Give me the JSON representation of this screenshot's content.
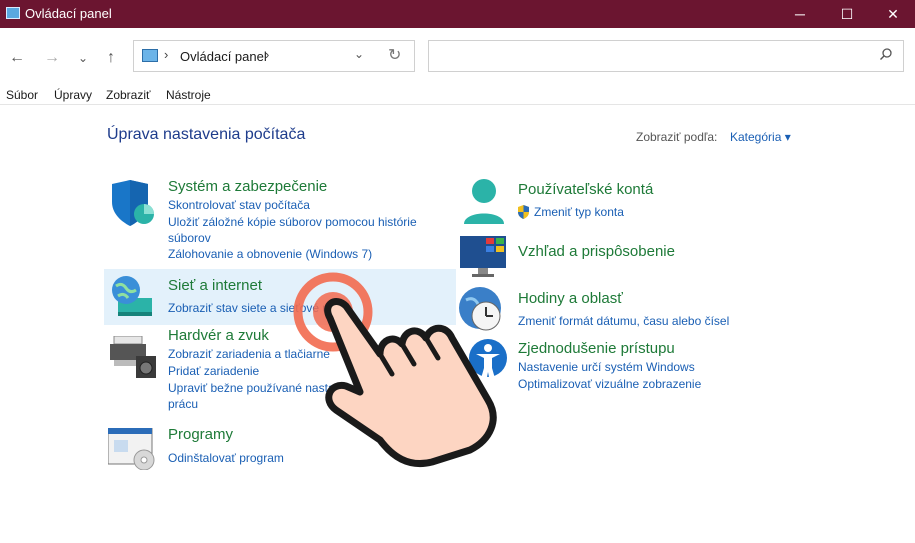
{
  "window": {
    "title": "Ovládací panel",
    "minimize": "─",
    "maximize": "☐",
    "close": "✕"
  },
  "nav": {
    "back": "←",
    "forward": "→",
    "recent": "⌄",
    "up": "↑"
  },
  "address": {
    "sep1": "›",
    "crumb": "Ovládací panel",
    "sep2": "›",
    "dropdown": "⌄",
    "refresh": "↻"
  },
  "search": {
    "placeholder": ""
  },
  "menu": [
    "Súbor",
    "Úpravy",
    "Zobraziť",
    "Nástroje"
  ],
  "main": {
    "title": "Úprava nastavenia počítača",
    "view_by_label": "Zobraziť podľa:",
    "view_by_value": "Kategória ▾"
  },
  "categories": {
    "system": {
      "title": "Systém a zabezpečenie",
      "links": [
        "Skontrolovať stav počítača",
        "Uložiť záložné kópie súborov pomocou histórie",
        "súborov",
        "Zálohovanie a obnovenie (Windows 7)"
      ]
    },
    "network": {
      "title": "Sieť a internet",
      "links": [
        "Zobraziť stav siete a sieťové úlohy"
      ]
    },
    "hardware": {
      "title": "Hardvér a zvuk",
      "links": [
        "Zobraziť zariadenia a tlačiarne",
        "Pridať zariadenie",
        "Upraviť bežne používané nastavenia mobility",
        "prácu"
      ]
    },
    "programs": {
      "title": "Programy",
      "links": [
        "Odinštalovať program"
      ]
    },
    "users": {
      "title": "Používateľské kontá",
      "links": [
        "Zmeniť typ konta"
      ]
    },
    "appearance": {
      "title": "Vzhľad a prispôsobenie",
      "links": []
    },
    "clock": {
      "title": "Hodiny a oblasť",
      "links": [
        "Zmeniť formát dátumu, času alebo čísel"
      ]
    },
    "access": {
      "title": "Zjednodušenie prístupu",
      "links": [
        "Nastavenie určí systém Windows",
        "Optimalizovať vizuálne zobrazenie"
      ]
    }
  },
  "colors": {
    "titlebar": "#6b1530",
    "category_head": "#1e7a38",
    "link": "#1a5fb4",
    "highlight": "#e3f1fb",
    "tap_ring": "#f26a4f",
    "hand_fill": "#fdd5c2"
  }
}
